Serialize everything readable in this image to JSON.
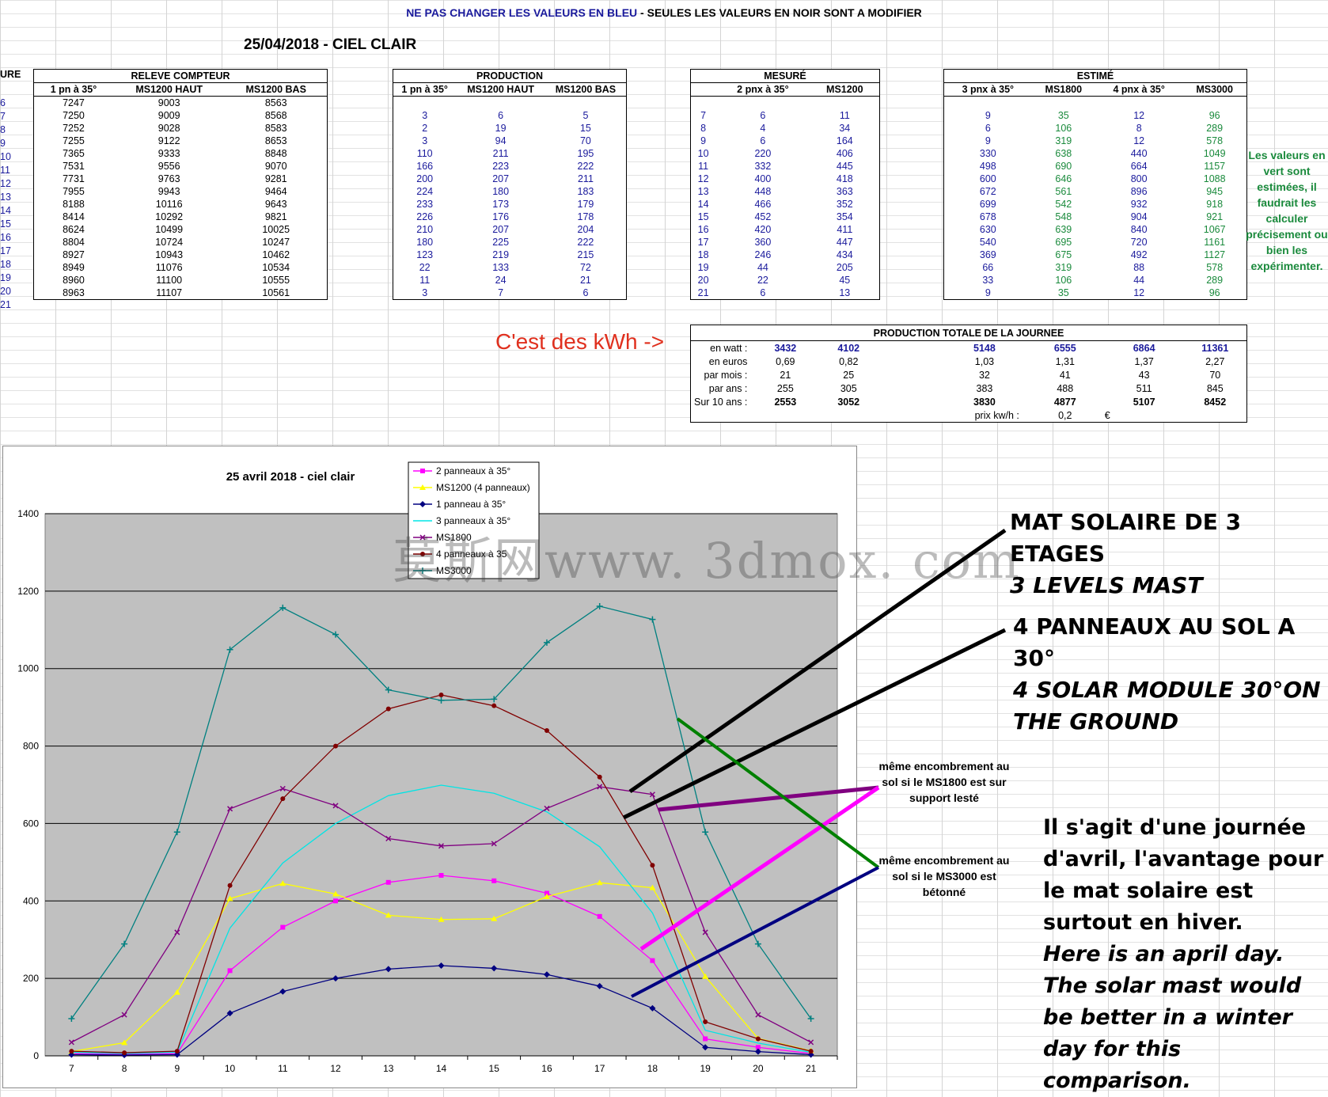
{
  "banner": {
    "blue_part": "NE PAS CHANGER LES VALEURS EN BLEU",
    "sep": " - ",
    "black_part": "SEULES LES VALEURS EN NOIR SONT A MODIFIER"
  },
  "sheet_title": "25/04/2018 - CIEL CLAIR",
  "heure_label": "URE",
  "heures_short": [
    "6",
    "7",
    "8",
    "9",
    "10",
    "11",
    "12",
    "13",
    "14",
    "15",
    "16",
    "17",
    "18",
    "19",
    "20",
    "21"
  ],
  "releve": {
    "title": "RELEVE COMPTEUR",
    "cols": [
      "1 pn à 35°",
      "MS1200 HAUT",
      "MS1200 BAS"
    ],
    "rows": [
      [
        "7247",
        "9003",
        "8563"
      ],
      [
        "7250",
        "9009",
        "8568"
      ],
      [
        "7252",
        "9028",
        "8583"
      ],
      [
        "7255",
        "9122",
        "8653"
      ],
      [
        "7365",
        "9333",
        "8848"
      ],
      [
        "7531",
        "9556",
        "9070"
      ],
      [
        "7731",
        "9763",
        "9281"
      ],
      [
        "7955",
        "9943",
        "9464"
      ],
      [
        "8188",
        "10116",
        "9643"
      ],
      [
        "8414",
        "10292",
        "9821"
      ],
      [
        "8624",
        "10499",
        "10025"
      ],
      [
        "8804",
        "10724",
        "10247"
      ],
      [
        "8927",
        "10943",
        "10462"
      ],
      [
        "8949",
        "11076",
        "10534"
      ],
      [
        "8960",
        "11100",
        "10555"
      ],
      [
        "8963",
        "11107",
        "10561"
      ]
    ]
  },
  "production": {
    "title": "PRODUCTION",
    "cols": [
      "1 pn à 35°",
      "MS1200 HAUT",
      "MS1200 BAS"
    ],
    "rows": [
      [
        "",
        "",
        ""
      ],
      [
        "3",
        "6",
        "5"
      ],
      [
        "2",
        "19",
        "15"
      ],
      [
        "3",
        "94",
        "70"
      ],
      [
        "110",
        "211",
        "195"
      ],
      [
        "166",
        "223",
        "222"
      ],
      [
        "200",
        "207",
        "211"
      ],
      [
        "224",
        "180",
        "183"
      ],
      [
        "233",
        "173",
        "179"
      ],
      [
        "226",
        "176",
        "178"
      ],
      [
        "210",
        "207",
        "204"
      ],
      [
        "180",
        "225",
        "222"
      ],
      [
        "123",
        "219",
        "215"
      ],
      [
        "22",
        "133",
        "72"
      ],
      [
        "11",
        "24",
        "21"
      ],
      [
        "3",
        "7",
        "6"
      ]
    ]
  },
  "mesure": {
    "title": "MESURÉ",
    "cols": [
      "",
      "2 pnx à 35°",
      "MS1200"
    ],
    "rows": [
      [
        "",
        "",
        ""
      ],
      [
        "7",
        "6",
        "11"
      ],
      [
        "8",
        "4",
        "34"
      ],
      [
        "9",
        "6",
        "164"
      ],
      [
        "10",
        "220",
        "406"
      ],
      [
        "11",
        "332",
        "445"
      ],
      [
        "12",
        "400",
        "418"
      ],
      [
        "13",
        "448",
        "363"
      ],
      [
        "14",
        "466",
        "352"
      ],
      [
        "15",
        "452",
        "354"
      ],
      [
        "16",
        "420",
        "411"
      ],
      [
        "17",
        "360",
        "447"
      ],
      [
        "18",
        "246",
        "434"
      ],
      [
        "19",
        "44",
        "205"
      ],
      [
        "20",
        "22",
        "45"
      ],
      [
        "21",
        "6",
        "13"
      ]
    ]
  },
  "estime": {
    "title": "ESTIMÉ",
    "cols": [
      "3 pnx à 35°",
      "MS1800",
      "4 pnx à 35°",
      "MS3000"
    ],
    "rows": [
      [
        "",
        "",
        "",
        ""
      ],
      [
        "9",
        "35",
        "12",
        "96"
      ],
      [
        "6",
        "106",
        "8",
        "289"
      ],
      [
        "9",
        "319",
        "12",
        "578"
      ],
      [
        "330",
        "638",
        "440",
        "1049"
      ],
      [
        "498",
        "690",
        "664",
        "1157"
      ],
      [
        "600",
        "646",
        "800",
        "1088"
      ],
      [
        "672",
        "561",
        "896",
        "945"
      ],
      [
        "699",
        "542",
        "932",
        "918"
      ],
      [
        "678",
        "548",
        "904",
        "921"
      ],
      [
        "630",
        "639",
        "840",
        "1067"
      ],
      [
        "540",
        "695",
        "720",
        "1161"
      ],
      [
        "369",
        "675",
        "492",
        "1127"
      ],
      [
        "66",
        "319",
        "88",
        "578"
      ],
      [
        "33",
        "106",
        "44",
        "289"
      ],
      [
        "9",
        "35",
        "12",
        "96"
      ]
    ],
    "green_cols": [
      1,
      3
    ]
  },
  "green_note": "Les valeurs en vert sont estimées, il faudrait les calculer précisement ou bien les expérimenter.",
  "kwh_label": "C'est des kWh ->",
  "totals": {
    "title": "PRODUCTION TOTALE DE LA JOURNEE",
    "rows": [
      {
        "label": "en watt :",
        "values": [
          "3432",
          "4102",
          "5148",
          "6555",
          "6864",
          "11361"
        ]
      },
      {
        "label": "en euros",
        "values": [
          "0,69",
          "0,82",
          "1,03",
          "1,31",
          "1,37",
          "2,27"
        ]
      },
      {
        "label": "par mois :",
        "values": [
          "21",
          "25",
          "32",
          "41",
          "43",
          "70"
        ]
      },
      {
        "label": "par ans :",
        "values": [
          "255",
          "305",
          "383",
          "488",
          "511",
          "845"
        ]
      },
      {
        "label": "Sur 10 ans :",
        "values": [
          "2553",
          "3052",
          "3830",
          "4877",
          "5107",
          "8452"
        ]
      }
    ],
    "prix_label": "prix kw/h :",
    "prix_value": "0,2",
    "prix_unit": "€"
  },
  "chart_data": {
    "type": "line",
    "title": "25 avril 2018 - ciel clair",
    "xlabel": "",
    "ylabel": "",
    "x": [
      7,
      8,
      9,
      10,
      11,
      12,
      13,
      14,
      15,
      16,
      17,
      18,
      19,
      20,
      21
    ],
    "ylim": [
      0,
      1400
    ],
    "yticks": [
      0,
      200,
      400,
      600,
      800,
      1000,
      1200,
      1400
    ],
    "grid": true,
    "legend": "top-center",
    "series": [
      {
        "name": "2 panneaux à 35°",
        "color": "#ff00ff",
        "marker": "square",
        "values": [
          6,
          4,
          6,
          220,
          332,
          400,
          448,
          466,
          452,
          420,
          360,
          246,
          44,
          22,
          6
        ]
      },
      {
        "name": "MS1200 (4 panneaux)",
        "color": "#ffff00",
        "marker": "triangle",
        "values": [
          11,
          34,
          164,
          406,
          445,
          418,
          363,
          352,
          354,
          411,
          447,
          434,
          205,
          45,
          13
        ]
      },
      {
        "name": "1 panneau à 35°",
        "color": "#000080",
        "marker": "diamond",
        "values": [
          3,
          2,
          3,
          110,
          166,
          200,
          224,
          233,
          226,
          210,
          180,
          123,
          22,
          11,
          3
        ]
      },
      {
        "name": "3 panneaux à 35°",
        "color": "#00e5e5",
        "marker": "none",
        "values": [
          9,
          6,
          9,
          330,
          498,
          600,
          672,
          699,
          678,
          630,
          540,
          369,
          66,
          33,
          9
        ]
      },
      {
        "name": "MS1800",
        "color": "#800080",
        "marker": "x",
        "values": [
          35,
          106,
          319,
          638,
          690,
          646,
          561,
          542,
          548,
          639,
          695,
          675,
          319,
          106,
          35
        ]
      },
      {
        "name": "4 panneaux à 35",
        "color": "#800000",
        "marker": "circle",
        "values": [
          12,
          8,
          12,
          440,
          664,
          800,
          896,
          932,
          904,
          840,
          720,
          492,
          88,
          44,
          12
        ]
      },
      {
        "name": "MS3000",
        "color": "#008080",
        "marker": "plus",
        "values": [
          96,
          289,
          578,
          1049,
          1157,
          1088,
          945,
          918,
          921,
          1067,
          1161,
          1127,
          578,
          289,
          96
        ]
      }
    ]
  },
  "watermark": "莫斯网www. 3dmox. com",
  "annotations": {
    "mast_fr": "MAT SOLAIRE DE 3 ETAGES",
    "mast_en": "3 LEVELS MAST",
    "ground_fr": "4 PANNEAUX AU SOL A 30°",
    "ground_en_1": "4 SOLAR MODULE 30°ON",
    "ground_en_2": "THE GROUND",
    "note_ms1800": "même encombrement au sol si le MS1800 est sur support lesté",
    "note_ms3000": "même encombrement au sol si le MS3000 est bétonné",
    "para_fr": "Il s'agit d'une journée d'avril, l'avantage pour le mat solaire est surtout en hiver.",
    "para_en": "Here is an april day. The solar mast would be better in a winter day for this comparison."
  }
}
